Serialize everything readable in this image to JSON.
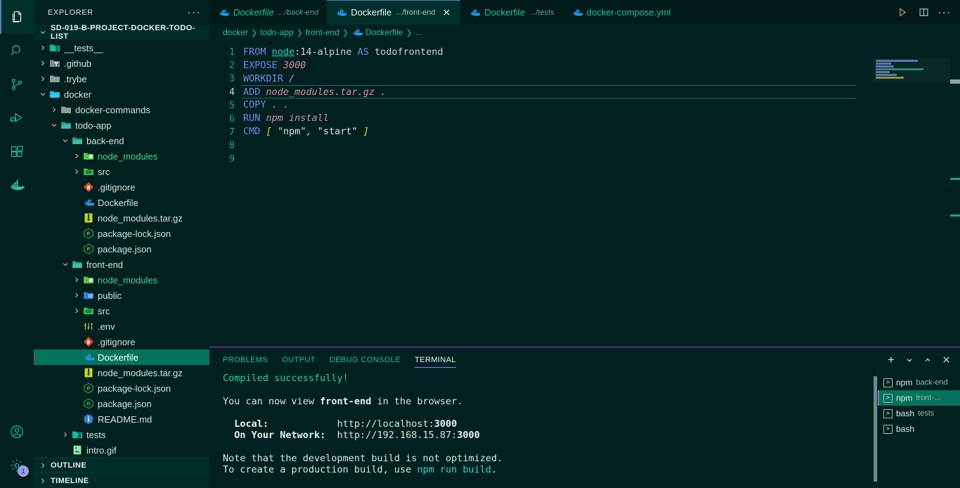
{
  "activitybar": {
    "items": [
      {
        "name": "explorer",
        "icon": "files-icon",
        "active": true
      },
      {
        "name": "search",
        "icon": "search-icon",
        "active": false
      },
      {
        "name": "source-control",
        "icon": "source-control-icon",
        "active": false
      },
      {
        "name": "run-and-debug",
        "icon": "run-debug-icon",
        "active": false
      },
      {
        "name": "extensions",
        "icon": "extensions-icon",
        "active": false
      },
      {
        "name": "docker",
        "icon": "docker-icon",
        "active": false
      }
    ],
    "bottom": [
      {
        "name": "accounts",
        "icon": "account-icon",
        "badge": ""
      },
      {
        "name": "manage",
        "icon": "gear-icon",
        "badge": "1"
      }
    ]
  },
  "sidebar": {
    "title": "EXPLORER",
    "more_label": "···",
    "root_label": "SD-019-B-PROJECT-DOCKER-TODO-LIST",
    "sections": [
      {
        "label": "OUTLINE"
      },
      {
        "label": "TIMELINE"
      }
    ],
    "tree": [
      {
        "label": "__tests__",
        "indent": 1,
        "twisty": "right",
        "icon": "folder-tests",
        "selected": false,
        "dim": false
      },
      {
        "label": ".github",
        "indent": 1,
        "twisty": "right",
        "icon": "folder-github",
        "selected": false,
        "dim": false
      },
      {
        "label": ".trybe",
        "indent": 1,
        "twisty": "right",
        "icon": "folder-plain",
        "selected": false,
        "dim": false
      },
      {
        "label": "docker",
        "indent": 1,
        "twisty": "down",
        "icon": "folder-open-docker",
        "selected": false,
        "dim": false
      },
      {
        "label": "docker-commands",
        "indent": 2,
        "twisty": "right",
        "icon": "folder-plain",
        "selected": false,
        "dim": false
      },
      {
        "label": "todo-app",
        "indent": 2,
        "twisty": "down",
        "icon": "folder-open",
        "selected": false,
        "dim": false
      },
      {
        "label": "back-end",
        "indent": 3,
        "twisty": "down",
        "icon": "folder-open",
        "selected": false,
        "dim": false
      },
      {
        "label": "node_modules",
        "indent": 4,
        "twisty": "right",
        "icon": "folder-node",
        "selected": false,
        "dim": true
      },
      {
        "label": "src",
        "indent": 4,
        "twisty": "right",
        "icon": "folder-src",
        "selected": false,
        "dim": false
      },
      {
        "label": ".gitignore",
        "indent": 4,
        "twisty": "none",
        "icon": "git-icon",
        "selected": false,
        "dim": false
      },
      {
        "label": "Dockerfile",
        "indent": 4,
        "twisty": "none",
        "icon": "docker-file-icon",
        "selected": false,
        "dim": false
      },
      {
        "label": "node_modules.tar.gz",
        "indent": 4,
        "twisty": "none",
        "icon": "zip-icon",
        "selected": false,
        "dim": false
      },
      {
        "label": "package-lock.json",
        "indent": 4,
        "twisty": "none",
        "icon": "npm-icon",
        "selected": false,
        "dim": false
      },
      {
        "label": "package.json",
        "indent": 4,
        "twisty": "none",
        "icon": "npm-icon",
        "selected": false,
        "dim": false
      },
      {
        "label": "front-end",
        "indent": 3,
        "twisty": "down",
        "icon": "folder-open",
        "selected": false,
        "dim": false
      },
      {
        "label": "node_modules",
        "indent": 4,
        "twisty": "right",
        "icon": "folder-node",
        "selected": false,
        "dim": true
      },
      {
        "label": "public",
        "indent": 4,
        "twisty": "right",
        "icon": "folder-public",
        "selected": false,
        "dim": false
      },
      {
        "label": "src",
        "indent": 4,
        "twisty": "right",
        "icon": "folder-src",
        "selected": false,
        "dim": false
      },
      {
        "label": ".env",
        "indent": 4,
        "twisty": "none",
        "icon": "env-icon",
        "selected": false,
        "dim": false
      },
      {
        "label": ".gitignore",
        "indent": 4,
        "twisty": "none",
        "icon": "git-icon",
        "selected": false,
        "dim": false
      },
      {
        "label": "Dockerfile",
        "indent": 4,
        "twisty": "none",
        "icon": "docker-file-icon",
        "selected": true,
        "dim": false
      },
      {
        "label": "node_modules.tar.gz",
        "indent": 4,
        "twisty": "none",
        "icon": "zip-icon",
        "selected": false,
        "dim": false
      },
      {
        "label": "package-lock.json",
        "indent": 4,
        "twisty": "none",
        "icon": "npm-icon",
        "selected": false,
        "dim": false
      },
      {
        "label": "package.json",
        "indent": 4,
        "twisty": "none",
        "icon": "npm-icon",
        "selected": false,
        "dim": false
      },
      {
        "label": "README.md",
        "indent": 4,
        "twisty": "none",
        "icon": "info-icon",
        "selected": false,
        "dim": false
      },
      {
        "label": "tests",
        "indent": 3,
        "twisty": "right",
        "icon": "folder-tests",
        "selected": false,
        "dim": false
      },
      {
        "label": "intro.gif",
        "indent": 3,
        "twisty": "none",
        "icon": "image-icon",
        "selected": false,
        "dim": false
      }
    ]
  },
  "tabs": [
    {
      "name": "Dockerfile",
      "desc": ".../back-end",
      "icon": "docker-file-icon",
      "active": false,
      "preview": true,
      "close": false
    },
    {
      "name": "Dockerfile",
      "desc": ".../front-end",
      "icon": "docker-file-icon",
      "active": true,
      "preview": false,
      "close": true
    },
    {
      "name": "Dockerfile",
      "desc": ".../tests",
      "icon": "docker-file-icon",
      "active": false,
      "preview": false,
      "close": false
    },
    {
      "name": "docker-compose.yml",
      "desc": "",
      "icon": "docker-file-icon",
      "active": false,
      "preview": false,
      "close": false
    }
  ],
  "editor_actions": [
    {
      "name": "run-button",
      "icon": "play-icon"
    },
    {
      "name": "split-editor-button",
      "icon": "split-editor-icon"
    },
    {
      "name": "more-actions-button",
      "icon": "ellipsis-icon",
      "label": "···"
    }
  ],
  "breadcrumb": [
    {
      "label": "docker",
      "icon": ""
    },
    {
      "label": "todo-app",
      "icon": ""
    },
    {
      "label": "front-end",
      "icon": ""
    },
    {
      "label": "Dockerfile",
      "icon": "docker-file-icon"
    },
    {
      "label": "...",
      "icon": ""
    }
  ],
  "editor": {
    "line_numbers": [
      "1",
      "2",
      "3",
      "4",
      "5",
      "6",
      "7",
      "8",
      "9"
    ],
    "current_line": 4,
    "lines": [
      {
        "n": 1,
        "tokens": [
          {
            "t": "FROM",
            "c": "kw"
          },
          {
            "t": " ",
            "c": "plain"
          },
          {
            "t": "node",
            "c": "img"
          },
          {
            "t": ":14-alpine",
            "c": "tagv"
          },
          {
            "t": " ",
            "c": "plain"
          },
          {
            "t": "AS",
            "c": "kw"
          },
          {
            "t": " ",
            "c": "plain"
          },
          {
            "t": "todofrontend",
            "c": "tagv"
          }
        ]
      },
      {
        "n": 2,
        "tokens": [
          {
            "t": "EXPOSE",
            "c": "kw"
          },
          {
            "t": " ",
            "c": "plain"
          },
          {
            "t": "3000",
            "c": "num"
          }
        ]
      },
      {
        "n": 3,
        "tokens": [
          {
            "t": "WORKDIR",
            "c": "kw"
          },
          {
            "t": " ",
            "c": "plain"
          },
          {
            "t": "/",
            "c": "path"
          }
        ]
      },
      {
        "n": 4,
        "tokens": [
          {
            "t": "ADD",
            "c": "kw"
          },
          {
            "t": " ",
            "c": "plain"
          },
          {
            "t": "node_modules.tar.gz .",
            "c": "path"
          }
        ]
      },
      {
        "n": 5,
        "tokens": [
          {
            "t": "COPY",
            "c": "kw"
          },
          {
            "t": " ",
            "c": "plain"
          },
          {
            "t": ". .",
            "c": "path"
          }
        ]
      },
      {
        "n": 6,
        "tokens": [
          {
            "t": "RUN",
            "c": "kw"
          },
          {
            "t": " ",
            "c": "plain"
          },
          {
            "t": "npm install",
            "c": "arg"
          }
        ]
      },
      {
        "n": 7,
        "tokens": [
          {
            "t": "CMD",
            "c": "kw"
          },
          {
            "t": " ",
            "c": "plain"
          },
          {
            "t": "[",
            "c": "brk"
          },
          {
            "t": " ",
            "c": "plain"
          },
          {
            "t": "\"npm\"",
            "c": "str"
          },
          {
            "t": ",",
            "c": "brk"
          },
          {
            "t": " ",
            "c": "plain"
          },
          {
            "t": "\"start\"",
            "c": "str"
          },
          {
            "t": " ",
            "c": "plain"
          },
          {
            "t": "]",
            "c": "brk"
          }
        ]
      },
      {
        "n": 8,
        "tokens": []
      },
      {
        "n": 9,
        "tokens": []
      }
    ]
  },
  "panel": {
    "tabs": [
      {
        "label": "PROBLEMS",
        "active": false
      },
      {
        "label": "OUTPUT",
        "active": false
      },
      {
        "label": "DEBUG CONSOLE",
        "active": false
      },
      {
        "label": "TERMINAL",
        "active": true
      }
    ],
    "actions": [
      {
        "name": "new-terminal-button",
        "icon": "plus-icon",
        "label": "+"
      },
      {
        "name": "terminal-dropdown-button",
        "icon": "chevron-down-icon",
        "label": "⌄"
      },
      {
        "name": "maximize-panel-button",
        "icon": "chevron-up-icon",
        "label": "⌃"
      },
      {
        "name": "close-panel-button",
        "icon": "close-icon",
        "label": "✕"
      }
    ],
    "terminal_lines": [
      [
        {
          "t": "Compiled successfully!",
          "c": "t-green"
        }
      ],
      [],
      [
        {
          "t": "You can now view ",
          "c": "plain"
        },
        {
          "t": "front-end",
          "c": "t-bold"
        },
        {
          "t": " in the browser.",
          "c": "plain"
        }
      ],
      [],
      [
        {
          "t": "  ",
          "c": "plain"
        },
        {
          "t": "Local:",
          "c": "t-bold"
        },
        {
          "t": "            http://localhost:",
          "c": "plain"
        },
        {
          "t": "3000",
          "c": "t-bold"
        }
      ],
      [
        {
          "t": "  ",
          "c": "plain"
        },
        {
          "t": "On Your Network:",
          "c": "t-bold"
        },
        {
          "t": "  http://192.168.15.87:",
          "c": "plain"
        },
        {
          "t": "3000",
          "c": "t-bold"
        }
      ],
      [],
      [
        {
          "t": "Note that the development build is not optimized.",
          "c": "plain"
        }
      ],
      [
        {
          "t": "To create a production build, use ",
          "c": "plain"
        },
        {
          "t": "npm run build",
          "c": "t-cyan"
        },
        {
          "t": ".",
          "c": "plain"
        }
      ]
    ],
    "terminal_list": [
      {
        "shell": "npm",
        "desc": "back-end",
        "selected": false
      },
      {
        "shell": "npm",
        "desc": "front-...",
        "selected": true
      },
      {
        "shell": "bash",
        "desc": "tests",
        "selected": false
      },
      {
        "shell": "bash",
        "desc": "",
        "selected": false
      }
    ]
  },
  "colors": {
    "editor_bg": "#00211f",
    "sidebar_bg": "#00211f",
    "accent_green": "#2dbda1",
    "selection_green": "#04735c",
    "panel_border": "#9b3fb5",
    "badge_bg": "#9b9ee8"
  }
}
